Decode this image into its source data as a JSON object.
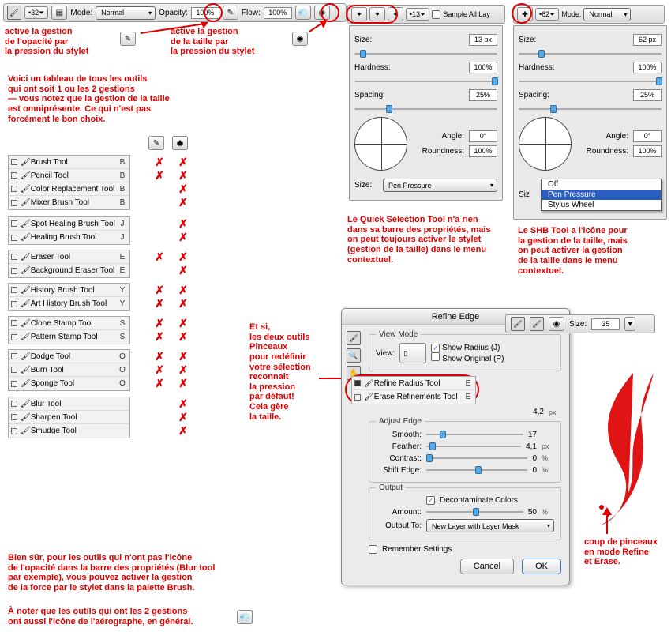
{
  "optbar": {
    "size": "32",
    "mode_lbl": "Mode:",
    "mode": "Normal",
    "opacity_lbl": "Opacity:",
    "opacity": "100%",
    "flow_lbl": "Flow:",
    "flow": "100%"
  },
  "ann": {
    "top_left": "active la gestion\nde l'opacité par\nla pression du stylet",
    "top_right": "active la gestion\nde la taille par\nla pression du stylet",
    "intro": "Voici un tableau de tous les outils\nqui ont soit 1 ou les 2 gestions\n— vous notez que la gestion de la taille\nest omniprésente. Ce qui n'est pas\nforcément le bon choix.",
    "qst": "Le Quick Sélection Tool n'a rien\ndans sa barre des propriétés, mais\non peut toujours activer le stylet\n(gestion de la taille) dans le menu\ncontextuel.",
    "shb": "Le SHB Tool a l'icône pour\nla gestion de la taille, mais\non peut activer la gestion\nde la taille dans le menu\ncontextuel.",
    "refine": "Et si,\nles deux outils\nPinceaux\npour redéfinir\nvotre sélection\nreconnait\nla pression\npar défaut!\nCela gère\nla taille.",
    "stroke": "coup de pinceaux\nen mode Refine\net Erase.",
    "bottom1": "Bien sûr, pour les outils qui n'ont pas l'icône\nde l'opacité dans la barre des propriétés (Blur tool\npar exemple), vous pouvez activer la gestion\nde la force par le stylet dans la palette Brush.",
    "bottom2": "À noter que les outils qui ont les 2 gestions\nont aussi l'icône de l'aérographe, en général."
  },
  "panel_left": {
    "hdr_sample": "Sample All Lay",
    "size_lbl": "Size:",
    "size": "13 px",
    "hard_lbl": "Hardness:",
    "hard": "100%",
    "spacing_lbl": "Spacing:",
    "spacing": "25%",
    "angle_lbl": "Angle:",
    "angle": "0°",
    "round_lbl": "Roundness:",
    "round": "100%",
    "ctrl_lbl": "Size:",
    "ctrl": "Pen Pressure",
    "brush_num": "13"
  },
  "panel_right": {
    "mode_lbl": "Mode:",
    "mode": "Normal",
    "brush_num": "62",
    "size_lbl": "Size:",
    "size": "62 px",
    "hard_lbl": "Hardness:",
    "hard": "100%",
    "spacing_lbl": "Spacing:",
    "spacing": "25%",
    "angle_lbl": "Angle:",
    "angle": "0°",
    "round_lbl": "Roundness:",
    "round": "100%",
    "ctrl_lbl": "Siz",
    "dd": [
      "Off",
      "Pen Pressure",
      "Stylus Wheel"
    ]
  },
  "tools": [
    {
      "group": [
        {
          "n": "Brush Tool",
          "k": "B"
        },
        {
          "n": "Pencil Tool",
          "k": "B"
        },
        {
          "n": "Color Replacement Tool",
          "k": "B"
        },
        {
          "n": "Mixer Brush Tool",
          "k": "B"
        }
      ]
    },
    {
      "group": [
        {
          "n": "Spot Healing Brush Tool",
          "k": "J"
        },
        {
          "n": "Healing Brush Tool",
          "k": "J"
        }
      ]
    },
    {
      "group": [
        {
          "n": "Eraser Tool",
          "k": "E"
        },
        {
          "n": "Background Eraser Tool",
          "k": "E"
        }
      ]
    },
    {
      "group": [
        {
          "n": "History Brush Tool",
          "k": "Y"
        },
        {
          "n": "Art History Brush Tool",
          "k": "Y"
        }
      ]
    },
    {
      "group": [
        {
          "n": "Clone Stamp Tool",
          "k": "S"
        },
        {
          "n": "Pattern Stamp Tool",
          "k": "S"
        }
      ]
    },
    {
      "group": [
        {
          "n": "Dodge Tool",
          "k": "O"
        },
        {
          "n": "Burn Tool",
          "k": "O"
        },
        {
          "n": "Sponge Tool",
          "k": "O"
        }
      ]
    },
    {
      "group": [
        {
          "n": "Blur Tool",
          "k": ""
        },
        {
          "n": "Sharpen Tool",
          "k": ""
        },
        {
          "n": "Smudge Tool",
          "k": ""
        }
      ]
    }
  ],
  "matrix": {
    "col1": [
      "✗",
      "✗",
      "",
      "",
      "",
      "",
      "✗",
      "",
      "✗",
      "✗",
      "✗",
      "✗",
      "✗",
      "✗",
      "✗",
      "",
      "",
      ""
    ],
    "col2": [
      "✗",
      "✗",
      "✗",
      "✗",
      "✗",
      "✗",
      "✗",
      "✗",
      "✗",
      "✗",
      "✗",
      "✗",
      "✗",
      "✗",
      "✗",
      "✗",
      "✗",
      "✗"
    ]
  },
  "refine": {
    "title": "Refine Edge",
    "view_lbl": "View Mode",
    "view": "View:",
    "show_radius": "Show Radius (J)",
    "show_orig": "Show Original (P)",
    "tools": [
      {
        "n": "Refine Radius Tool",
        "k": "E"
      },
      {
        "n": "Erase Refinements Tool",
        "k": "E"
      }
    ],
    "radius": "4,2",
    "radius_u": "px",
    "adjust_lbl": "Adjust Edge",
    "smooth_lbl": "Smooth:",
    "smooth": "17",
    "feather_lbl": "Feather:",
    "feather": "4,1",
    "feather_u": "px",
    "contrast_lbl": "Contrast:",
    "contrast": "0",
    "contrast_u": "%",
    "shift_lbl": "Shift Edge:",
    "shift": "0",
    "shift_u": "%",
    "output_lbl": "Output",
    "decon": "Decontaminate Colors",
    "amount_lbl": "Amount:",
    "amount": "50",
    "amount_u": "%",
    "out_to_lbl": "Output To:",
    "out_to": "New Layer with Layer Mask",
    "remember": "Remember Settings",
    "cancel": "Cancel",
    "ok": "OK"
  },
  "sizebar": {
    "size_lbl": "Size:",
    "size": "35"
  }
}
